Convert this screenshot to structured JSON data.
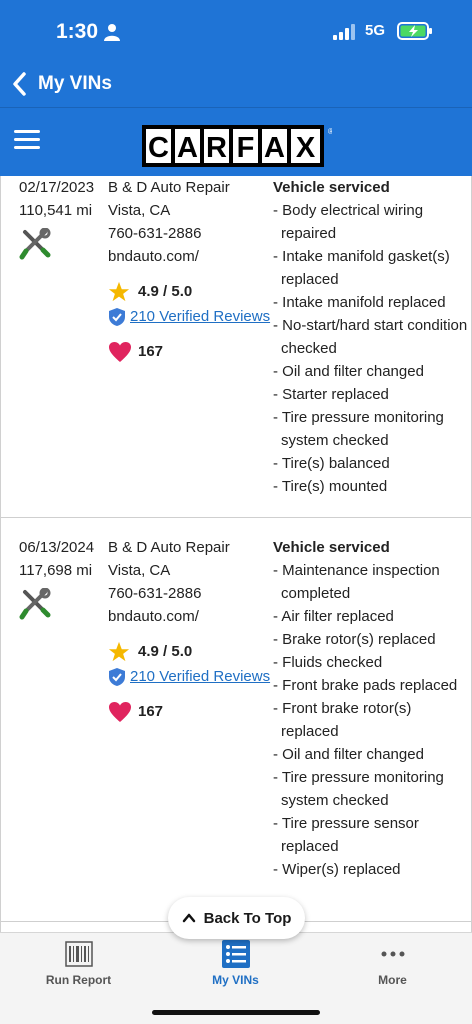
{
  "status": {
    "time": "1:30",
    "network": "5G"
  },
  "nav": {
    "back_label": "My VINs"
  },
  "brand": {
    "logo_letters": [
      "C",
      "A",
      "R",
      "F",
      "A",
      "X"
    ],
    "logo_mark": "®"
  },
  "records": [
    {
      "date": "02/17/2023",
      "mileage": "110,541 mi",
      "shop_name": "B & D Auto Repair",
      "location": "Vista, CA",
      "phone": "760-631-2886",
      "website": "bndauto.com/",
      "rating": "4.9 / 5.0",
      "reviews": "210 Verified Reviews",
      "favorites": "167",
      "service_header": "Vehicle serviced",
      "services": [
        "- Body electrical wiring repaired",
        "- Intake manifold gasket(s) replaced",
        "- Intake manifold replaced",
        "- No-start/hard start condition checked",
        "- Oil and filter changed",
        "- Starter replaced",
        "- Tire pressure monitoring system checked",
        "- Tire(s) balanced",
        "- Tire(s) mounted"
      ]
    },
    {
      "date": "06/13/2024",
      "mileage": "117,698 mi",
      "shop_name": "B & D Auto Repair",
      "location": "Vista, CA",
      "phone": "760-631-2886",
      "website": "bndauto.com/",
      "rating": "4.9 / 5.0",
      "reviews": "210 Verified Reviews",
      "favorites": "167",
      "service_header": "Vehicle serviced",
      "services": [
        "- Maintenance inspection completed",
        "- Air filter replaced",
        "- Brake rotor(s) replaced",
        "- Fluids checked",
        "- Front brake pads replaced",
        "- Front brake rotor(s) replaced",
        "- Oil and filter changed",
        "- Tire pressure monitoring system checked",
        "- Tire pressure sensor replaced",
        "- Wiper(s) replaced"
      ]
    }
  ],
  "back_to_top": "Back To Top",
  "tabs": [
    {
      "label": "Run Report",
      "icon": "barcode-icon"
    },
    {
      "label": "My VINs",
      "icon": "list-icon"
    },
    {
      "label": "More",
      "icon": "more-dots-icon"
    }
  ],
  "colors": {
    "brand_blue": "#1f74d6",
    "link_blue": "#1f6fc4",
    "star": "#f5b800",
    "heart": "#e0245e",
    "wrench_green": "#2e8b2e"
  }
}
